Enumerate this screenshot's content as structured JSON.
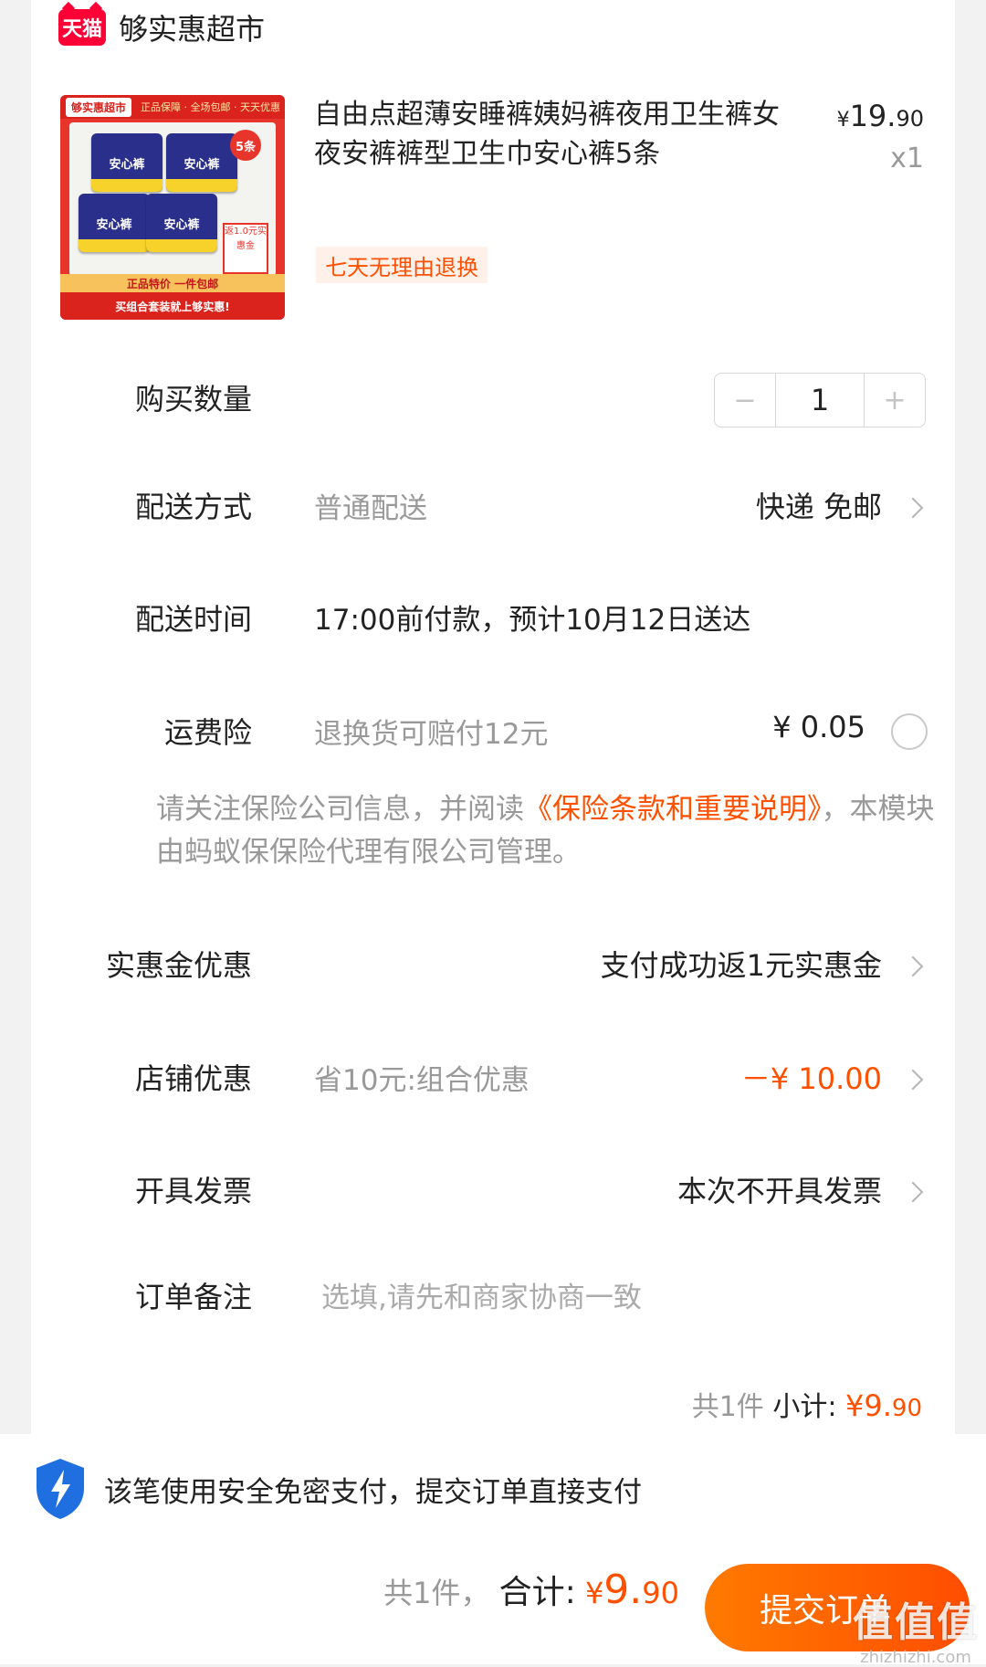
{
  "store": {
    "badge": "天猫",
    "name": "够实惠超市"
  },
  "product": {
    "title": "自由点超薄安睡裤姨妈裤夜用卫生裤女夜安裤裤型卫生巾安心裤5条",
    "price_yen": "¥",
    "price_int": "19.",
    "price_dec": "90",
    "quantity_label": "x1",
    "return_policy": "七天无理由退换",
    "image": {
      "brand": "够实惠超市",
      "tagline": "正品保障 · 全场包邮 · 天天优惠",
      "pack_text": "安心裤",
      "count_badge": "5条",
      "refund_tag": "返1.0元实惠金",
      "bar1": "正品特价  一件包邮",
      "bar2": "买组合套装就上够实惠!"
    }
  },
  "quantity": {
    "label": "购买数量",
    "minus": "−",
    "value": "1",
    "plus": "+"
  },
  "delivery": {
    "label": "配送方式",
    "method": "普通配送",
    "value": "快递 免邮"
  },
  "delivery_time": {
    "label": "配送时间",
    "value": "17:00前付款，预计10月12日送达"
  },
  "shipping_insurance": {
    "label": "运费险",
    "desc": "退换货可赔付12元",
    "price": "¥ 0.05"
  },
  "insurance_note": {
    "prefix": "请关注保险公司信息，并阅读",
    "link": "《保险条款和重要说明》",
    "suffix": "，本模块由蚂蚁保保险代理有限公司管理。"
  },
  "cashback": {
    "label": "实惠金优惠",
    "value": "支付成功返1元实惠金"
  },
  "store_discount": {
    "label": "店铺优惠",
    "desc": "省10元:组合优惠",
    "value": "－¥ 10.00"
  },
  "invoice": {
    "label": "开具发票",
    "value": "本次不开具发票"
  },
  "order_note": {
    "label": "订单备注",
    "placeholder": "选填,请先和商家协商一致"
  },
  "subtotal": {
    "count": "共1件",
    "label": "小计:",
    "yen": "¥",
    "int": "9.",
    "dec": "90"
  },
  "secure_payment": {
    "text": "该笔使用安全免密支付，提交订单直接支付"
  },
  "footer": {
    "count": "共1件，",
    "label": "合计:",
    "yen": "¥",
    "int": "9.",
    "dec": "90",
    "submit_label": "提交订单"
  },
  "watermark": {
    "text": "值值值",
    "url": "zhizhizhi.com"
  },
  "colors": {
    "accent": "#ff5000",
    "tmall_red": "#ff0036",
    "muted": "#999999",
    "shield_blue": "#1f6fe0"
  }
}
